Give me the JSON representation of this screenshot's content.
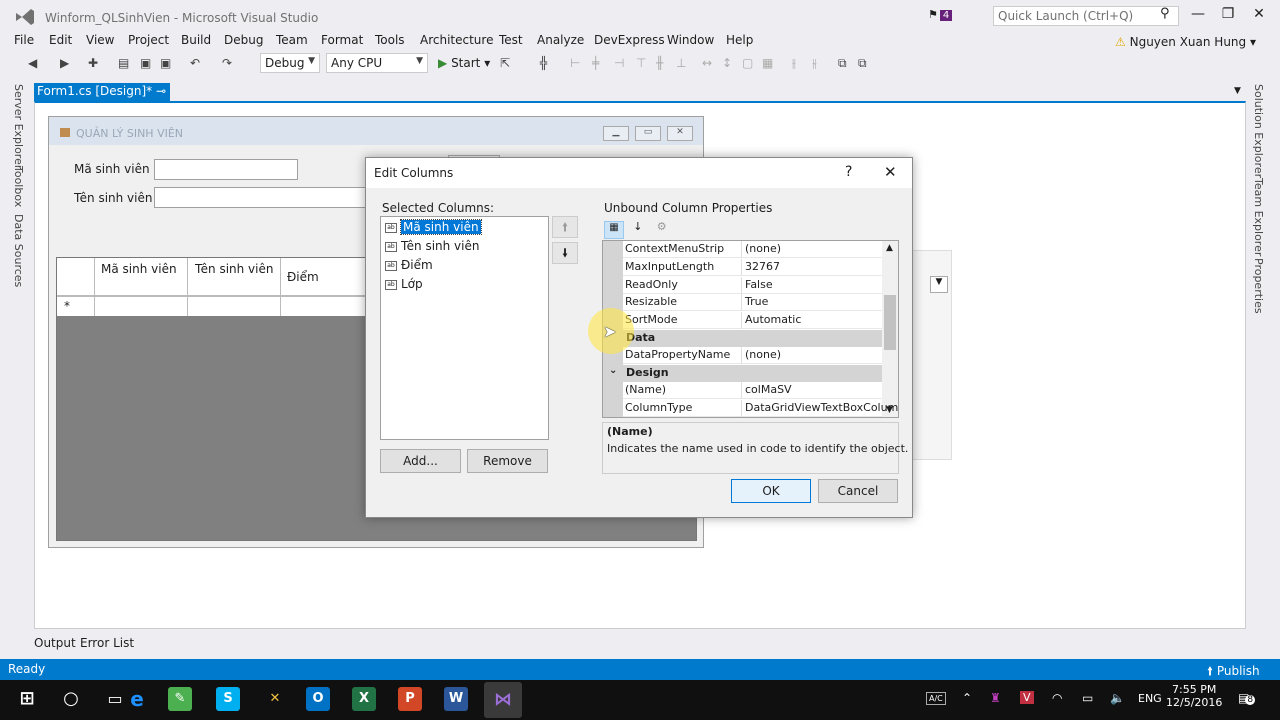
{
  "window": {
    "title": "Winform_QLSinhVien - Microsoft Visual Studio",
    "notification_count": "4",
    "quick_launch_placeholder": "Quick Launch (Ctrl+Q)",
    "user": "Nguyen Xuan Hung"
  },
  "menu": [
    "File",
    "Edit",
    "View",
    "Project",
    "Build",
    "Debug",
    "Team",
    "Format",
    "Tools",
    "Architecture",
    "Test",
    "Analyze",
    "DevExpress",
    "Window",
    "Help"
  ],
  "toolbar": {
    "config": "Debug",
    "platform": "Any CPU",
    "start": "Start"
  },
  "left_strip": [
    "Server Explorer",
    "Toolbox",
    "Data Sources"
  ],
  "right_strip": [
    "Solution Explorer",
    "Team Explorer",
    "Properties"
  ],
  "doc_tab": "Form1.cs [Design]*",
  "form": {
    "title": "QUẢN LÝ SINH VIÊN",
    "label_ma": "Mã sinh viên",
    "label_ten": "Tên sinh viên",
    "grid_headers": [
      "Mã sinh viên",
      "Tên sinh viên",
      "Điểm"
    ],
    "new_row_marker": "*"
  },
  "dialog": {
    "title": "Edit Columns",
    "help": "?",
    "selected_label": "Selected Columns:",
    "columns": [
      "Mã sinh viên",
      "Tên sinh viên",
      "Điểm",
      "Lớp"
    ],
    "selected_index": 0,
    "add_label": "Add...",
    "remove_label": "Remove",
    "props_label": "Unbound Column Properties",
    "properties": [
      {
        "name": "ContextMenuStrip",
        "value": "(none)"
      },
      {
        "name": "MaxInputLength",
        "value": "32767"
      },
      {
        "name": "ReadOnly",
        "value": "False"
      },
      {
        "name": "Resizable",
        "value": "True"
      },
      {
        "name": "SortMode",
        "value": "Automatic"
      }
    ],
    "category_data": "Data",
    "data_props": [
      {
        "name": "DataPropertyName",
        "value": "(none)"
      }
    ],
    "category_design": "Design",
    "design_props": [
      {
        "name": "(Name)",
        "value": "colMaSV"
      },
      {
        "name": "ColumnType",
        "value": "DataGridViewTextBoxColum"
      }
    ],
    "desc_title": "(Name)",
    "desc_text": "Indicates the name used in code to identify the object.",
    "ok_label": "OK",
    "cancel_label": "Cancel"
  },
  "bottom_tabs": [
    "Output",
    "Error List"
  ],
  "status": {
    "text": "Ready",
    "publish": "Publish"
  },
  "taskbar": {
    "lang": "ENG",
    "time": "7:55 PM",
    "date": "12/5/2016",
    "notifications": "8"
  }
}
